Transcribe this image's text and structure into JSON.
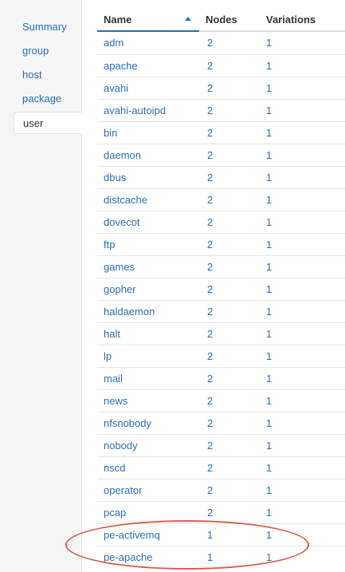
{
  "sidebar": {
    "items": [
      {
        "label": "Summary",
        "active": false
      },
      {
        "label": "group",
        "active": false
      },
      {
        "label": "host",
        "active": false
      },
      {
        "label": "package",
        "active": false
      },
      {
        "label": "user",
        "active": true
      }
    ]
  },
  "table": {
    "columns": {
      "name": "Name",
      "nodes": "Nodes",
      "variations": "Variations"
    },
    "sort": {
      "column": "Name",
      "direction": "ascending"
    },
    "rows": [
      {
        "name": "adm",
        "nodes": "2",
        "variations": "1"
      },
      {
        "name": "apache",
        "nodes": "2",
        "variations": "1"
      },
      {
        "name": "avahi",
        "nodes": "2",
        "variations": "1"
      },
      {
        "name": "avahi-autoipd",
        "nodes": "2",
        "variations": "1"
      },
      {
        "name": "bin",
        "nodes": "2",
        "variations": "1"
      },
      {
        "name": "daemon",
        "nodes": "2",
        "variations": "1"
      },
      {
        "name": "dbus",
        "nodes": "2",
        "variations": "1"
      },
      {
        "name": "distcache",
        "nodes": "2",
        "variations": "1"
      },
      {
        "name": "dovecot",
        "nodes": "2",
        "variations": "1"
      },
      {
        "name": "ftp",
        "nodes": "2",
        "variations": "1"
      },
      {
        "name": "games",
        "nodes": "2",
        "variations": "1"
      },
      {
        "name": "gopher",
        "nodes": "2",
        "variations": "1"
      },
      {
        "name": "haldaemon",
        "nodes": "2",
        "variations": "1"
      },
      {
        "name": "halt",
        "nodes": "2",
        "variations": "1"
      },
      {
        "name": "lp",
        "nodes": "2",
        "variations": "1"
      },
      {
        "name": "mail",
        "nodes": "2",
        "variations": "1"
      },
      {
        "name": "news",
        "nodes": "2",
        "variations": "1"
      },
      {
        "name": "nfsnobody",
        "nodes": "2",
        "variations": "1"
      },
      {
        "name": "nobody",
        "nodes": "2",
        "variations": "1"
      },
      {
        "name": "nscd",
        "nodes": "2",
        "variations": "1"
      },
      {
        "name": "operator",
        "nodes": "2",
        "variations": "1"
      },
      {
        "name": "pcap",
        "nodes": "2",
        "variations": "1"
      },
      {
        "name": "pe-activemq",
        "nodes": "1",
        "variations": "1"
      },
      {
        "name": "pe-apache",
        "nodes": "1",
        "variations": "1"
      }
    ]
  },
  "colors": {
    "link": "#2a6eb8",
    "annotation": "#d9604a",
    "sidebar_bg": "#f5f5f5"
  }
}
